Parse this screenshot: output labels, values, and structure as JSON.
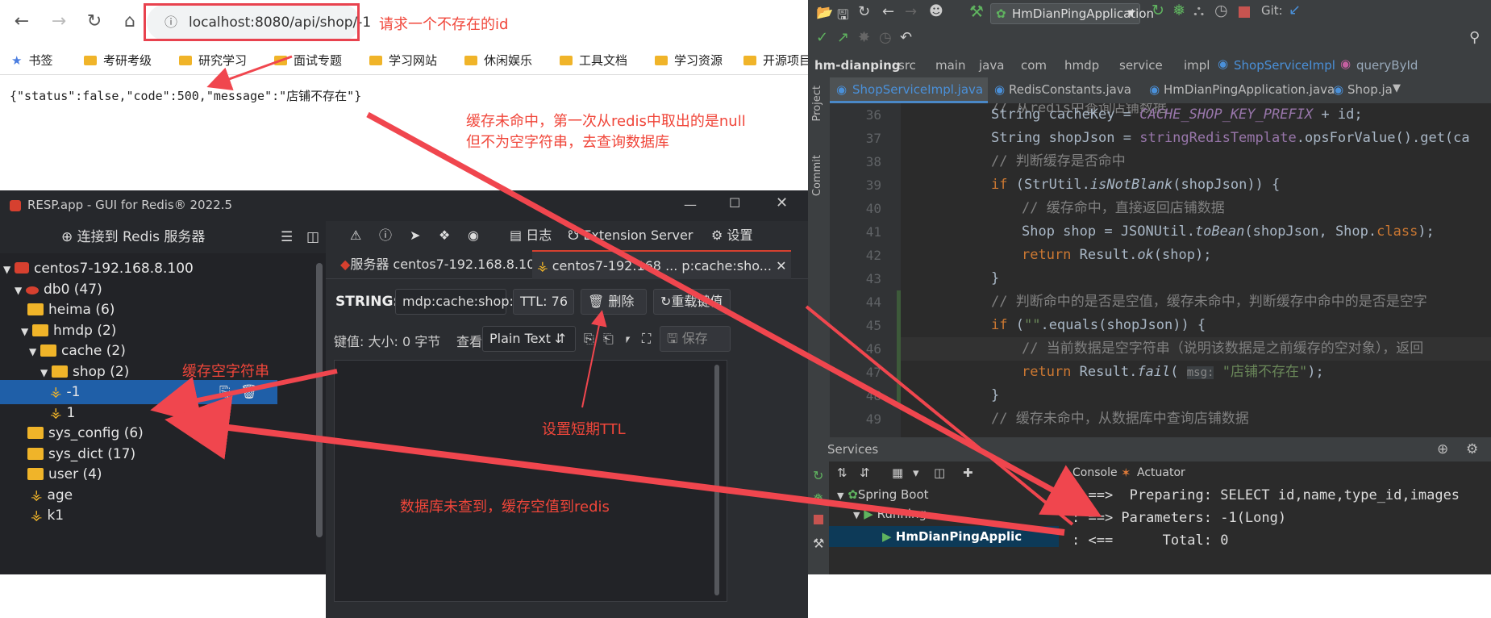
{
  "browser": {
    "url": "localhost:8080/api/shop/-1",
    "bookmarks": [
      "书签",
      "考研考级",
      "研究学习",
      "面试专题",
      "学习网站",
      "休闲娱乐",
      "工具文档",
      "学习资源",
      "开源项目"
    ],
    "body_text": "{\"status\":false,\"code\":500,\"message\":\"店铺不存在\"}"
  },
  "annotations": {
    "url_note": "请求一个不存在的id",
    "cache_miss_1": "缓存未命中，第一次从redis中取出的是null",
    "cache_miss_2": "但不为空字符串，去查询数据库",
    "cache_empty": "缓存空字符串",
    "short_ttl": "设置短期TTL",
    "db_miss": "数据库未查到，缓存空值到redis"
  },
  "resp": {
    "title": "RESP.app - GUI for Redis® 2022.5",
    "connect": "连接到 Redis 服务器",
    "toolbar": {
      "log": "日志",
      "ext": "Extension Server",
      "settings": "设置"
    },
    "tabs": [
      "服务器 centos7-192.168.8.100",
      "centos7-192.168 ... p:cache:sho..."
    ],
    "tree": [
      {
        "label": "centos7-192.168.8.100",
        "kind": "server",
        "level": 0
      },
      {
        "label": "db0  (47)",
        "kind": "db",
        "level": 1
      },
      {
        "label": "heima (6)",
        "kind": "folder",
        "level": 2
      },
      {
        "label": "hmdp (2)",
        "kind": "folder",
        "level": 2
      },
      {
        "label": "cache (2)",
        "kind": "folder",
        "level": 3
      },
      {
        "label": "shop (2)",
        "kind": "folder",
        "level": 4
      },
      {
        "label": "-1",
        "kind": "key",
        "level": 5,
        "selected": true
      },
      {
        "label": "1",
        "kind": "key",
        "level": 5
      },
      {
        "label": "sys_config (6)",
        "kind": "folder",
        "level": 2
      },
      {
        "label": "sys_dict (17)",
        "kind": "folder",
        "level": 2
      },
      {
        "label": "user (4)",
        "kind": "folder",
        "level": 2
      },
      {
        "label": "age",
        "kind": "key",
        "level": 2
      },
      {
        "label": "k1",
        "kind": "key",
        "level": 2
      }
    ],
    "type_label": "STRING:",
    "key_name": "mdp:cache:shop:",
    "ttl": "TTL:  76",
    "delete": "删除",
    "reload": "重载键值",
    "value_size": "键值: 大小:  0 字节",
    "view_label": "查看",
    "view_mode": "Plain Text",
    "save": "保存"
  },
  "ide": {
    "run_config": "HmDianPingApplication",
    "git": "Git:",
    "breadcrumb": [
      "hm-dianping",
      "src",
      "main",
      "java",
      "com",
      "hmdp",
      "service",
      "impl",
      "ShopServiceImpl",
      "queryById"
    ],
    "tabs": [
      "ShopServiceImpl.java",
      "RedisConstants.java",
      "HmDianPingApplication.java",
      "Shop.ja"
    ],
    "side": [
      "Project",
      "Commit"
    ],
    "line_numbers": [
      "36",
      "37",
      "38",
      "39",
      "40",
      "41",
      "42",
      "43",
      "44",
      "45",
      "46",
      "47",
      "48",
      "49"
    ],
    "services_title": "Services",
    "console_tabs": [
      "Console",
      "Actuator"
    ],
    "svc_tree": [
      "Spring Boot",
      "Running",
      "HmDianPingApplic"
    ],
    "console": [
      ": ==>  Preparing: SELECT id,name,type_id,images",
      ": ==> Parameters: -1(Long)",
      ": <==      Total: 0"
    ]
  }
}
